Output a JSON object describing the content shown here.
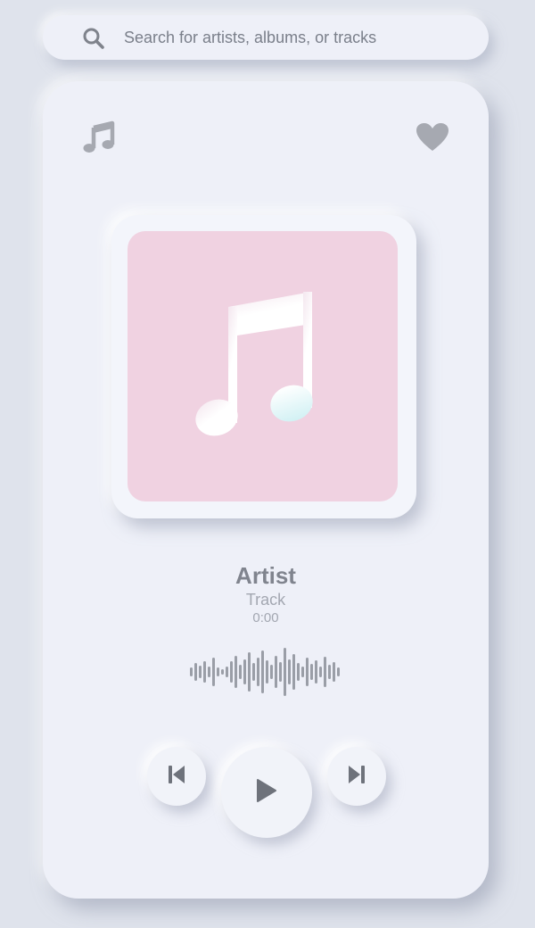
{
  "search": {
    "placeholder": "Search for artists, albums, or tracks"
  },
  "player": {
    "artist": "Artist",
    "track": "Track",
    "time": "0:00"
  },
  "icons": {
    "search": "search-icon",
    "note": "music-note-icon",
    "favorite": "heart-icon",
    "previous": "skip-previous-icon",
    "play": "play-icon",
    "next": "skip-next-icon"
  },
  "colors": {
    "background": "#dfe3ec",
    "surface": "#eef0f8",
    "art_background": "#f0d2e1",
    "icon": "#a6a9b1",
    "text_primary": "#80848e",
    "text_secondary": "#a3a7b1"
  }
}
